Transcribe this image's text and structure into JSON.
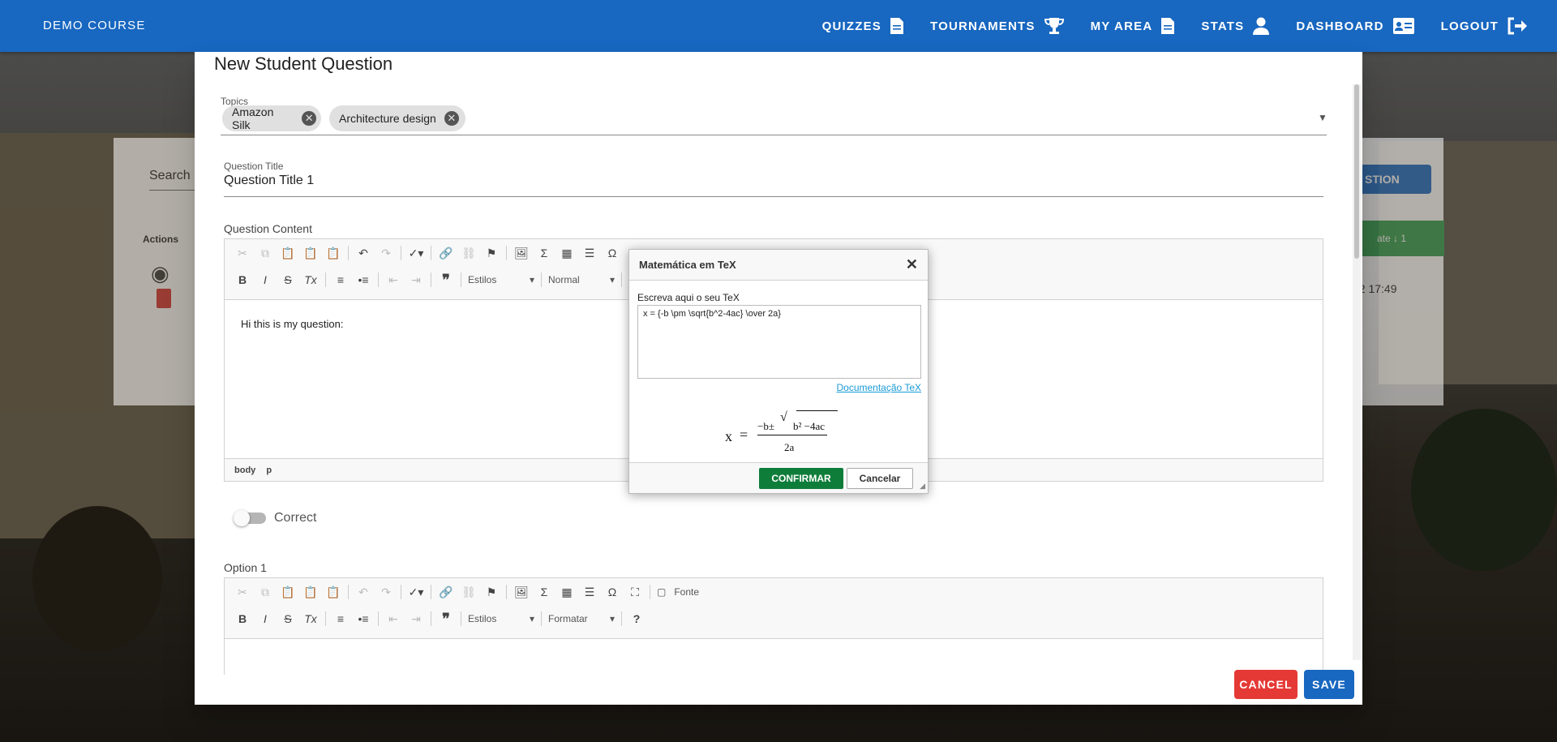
{
  "app": {
    "brand": "DEMO COURSE"
  },
  "nav": [
    {
      "label": "QUIZZES",
      "icon": "document-icon"
    },
    {
      "label": "TOURNAMENTS",
      "icon": "trophy-icon"
    },
    {
      "label": "MY AREA",
      "icon": "document-icon"
    },
    {
      "label": "STATS",
      "icon": "person-icon"
    },
    {
      "label": "DASHBOARD",
      "icon": "id-card-icon"
    },
    {
      "label": "LOGOUT",
      "icon": "logout-icon"
    }
  ],
  "background_page": {
    "search_label": "Search",
    "actions_header": "Actions",
    "new_question_button": "STION",
    "sort_button": "ate ↓  1",
    "date_fragment": "22 17:49"
  },
  "dialog": {
    "title": "New Student Question",
    "topics_label": "Topics",
    "topics": [
      "Amazon Silk",
      "Architecture design"
    ],
    "question_title_label": "Question Title",
    "question_title_value": "Question Title 1",
    "question_content_label": "Question Content",
    "question_content_text": "Hi this is my question:",
    "styles_combo": "Estilos",
    "format_combo_1": "Normal",
    "status_path": [
      "body",
      "p"
    ],
    "correct_label": "Correct",
    "option_label": "Option 1",
    "format_combo_2": "Formatar",
    "fonte_label": "Fonte",
    "cancel_button": "CANCEL",
    "save_button": "SAVE"
  },
  "tex_dialog": {
    "title": "Matemática em TeX",
    "prompt": "Escreva aqui o seu TeX",
    "tex_value": "x = {-b \\pm \\sqrt{b^2-4ac} \\over 2a}",
    "doc_link": "Documentação TeX",
    "preview": {
      "lhs": "x",
      "eq": "=",
      "numerator": "−b±",
      "radicand": "b² −4ac",
      "denominator": "2a"
    },
    "confirm_button": "CONFIRMAR",
    "cancel_button": "Cancelar"
  },
  "colors": {
    "primary": "#1867c0",
    "danger": "#e53935",
    "confirm": "#0f7d3a",
    "link": "#1a9bd6"
  }
}
